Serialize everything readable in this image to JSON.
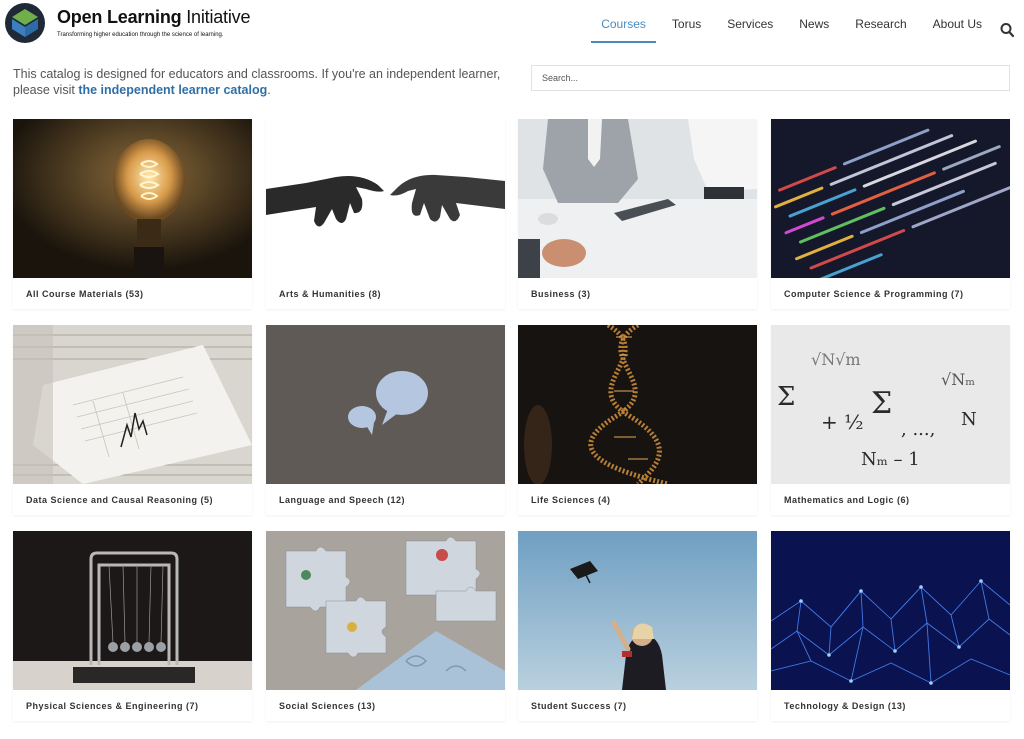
{
  "header": {
    "brand_bold": "Open Learning",
    "brand_light": "Initiative",
    "tagline": "Transforming higher education through the science of learning.",
    "nav": [
      {
        "label": "Courses",
        "active": true
      },
      {
        "label": "Torus",
        "active": false
      },
      {
        "label": "Services",
        "active": false
      },
      {
        "label": "News",
        "active": false
      },
      {
        "label": "Research",
        "active": false
      },
      {
        "label": "About Us",
        "active": false
      }
    ],
    "search_icon": "search-icon"
  },
  "intro": {
    "text": "This catalog is designed for educators and classrooms. If you're an independent learner, please visit ",
    "link": "the independent learner catalog",
    "after": "."
  },
  "search": {
    "placeholder": "Search..."
  },
  "categories": [
    {
      "label": "All Course Materials (53)"
    },
    {
      "label": "Arts & Humanities (8)"
    },
    {
      "label": "Business (3)"
    },
    {
      "label": "Computer Science & Programming (7)"
    },
    {
      "label": "Data Science and Causal Reasoning (5)"
    },
    {
      "label": "Language and Speech (12)"
    },
    {
      "label": "Life Sciences (4)"
    },
    {
      "label": "Mathematics and Logic (6)"
    },
    {
      "label": "Physical Sciences & Engineering (7)"
    },
    {
      "label": "Social Sciences (13)"
    },
    {
      "label": "Student Success (7)"
    },
    {
      "label": "Technology & Design (13)"
    }
  ],
  "colors": {
    "accent": "#4a8bbf",
    "link": "#2f6fa8"
  }
}
